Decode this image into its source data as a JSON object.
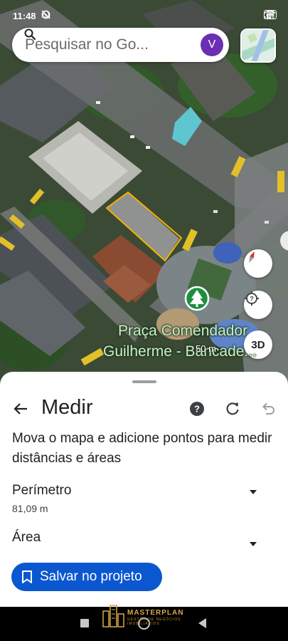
{
  "status_bar": {
    "time": "11:48",
    "battery": "60"
  },
  "search": {
    "placeholder": "Pesquisar no Go...",
    "avatar_initial": "V"
  },
  "map": {
    "poi_name_line1": "Praça Comendador",
    "poi_name_line2": "Guilherme - Bancade...",
    "scale": "50 m",
    "view_3d_label": "3D",
    "colors": {
      "measure_outline": "#f5b301",
      "poi_marker": "#1e8e3e",
      "poi_text": "#cdebc9"
    }
  },
  "sheet": {
    "title": "Medir",
    "instructions": "Mova o mapa e adicione pontos para medir distâncias e áreas",
    "perimeter": {
      "label": "Perímetro",
      "value": "81,09 m"
    },
    "area": {
      "label": "Área",
      "value": ""
    },
    "save_button": "Salvar no projeto",
    "icons": {
      "back": "arrow-left-icon",
      "help": "help-icon",
      "reset": "refresh-icon",
      "undo": "undo-icon"
    }
  },
  "watermark": {
    "name": "MASTERPLAN",
    "subtitle": "GESTÃO DE NEGÓCIOS IMOBILIÁRIOS"
  },
  "accent_color": "#0b57d0"
}
